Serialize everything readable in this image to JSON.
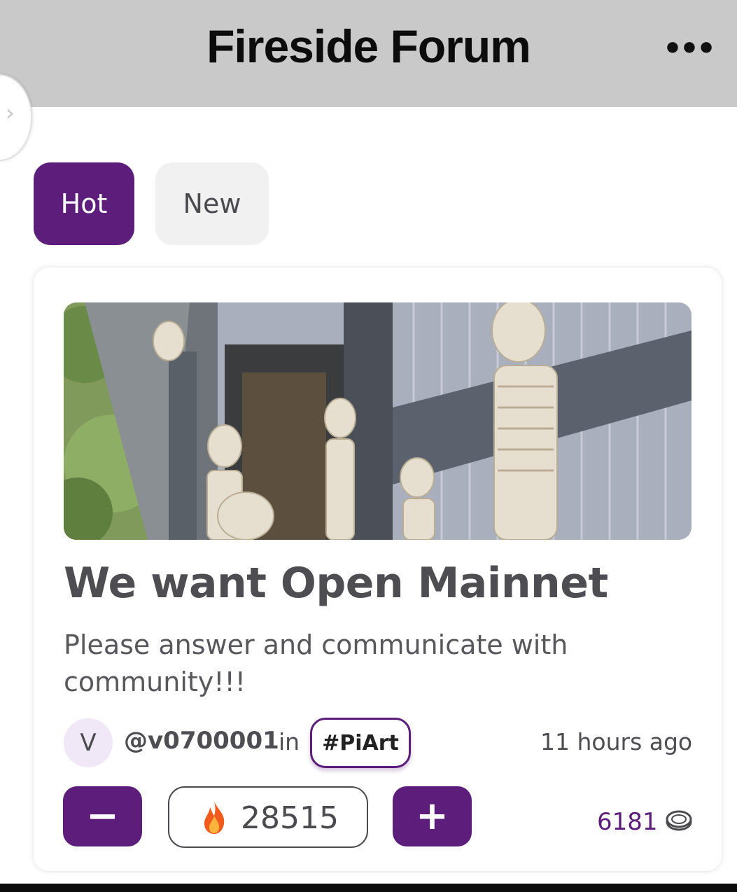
{
  "header": {
    "title": "Fireside Forum",
    "menu_label": "•••"
  },
  "tabs": [
    {
      "label": "Hot",
      "active": true
    },
    {
      "label": "New",
      "active": false
    }
  ],
  "post": {
    "title": "We want Open Mainnet",
    "body": "Please answer and communicate with community!!!",
    "author_initial": "V",
    "author": "@v0700001",
    "in_label": "in",
    "tag": "#PiArt",
    "timestamp": "11 hours ago",
    "score": "28515",
    "downvote_label": "−",
    "upvote_label": "+",
    "coins": "6181"
  },
  "icons": {
    "menu": "more-dots-icon",
    "drawer": "chevron-right-icon",
    "score": "fire-icon",
    "coins": "coin-icon"
  },
  "colors": {
    "accent": "#5c1e7a",
    "header_bg": "#c9c9c9"
  }
}
